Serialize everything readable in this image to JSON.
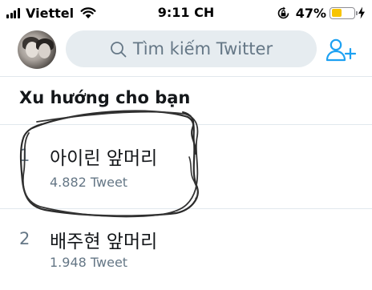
{
  "status_bar": {
    "carrier": "Viettel",
    "time": "9:11 CH",
    "battery_percent": "47%",
    "battery_level": 0.47,
    "icons": [
      "signal-icon",
      "wifi-icon",
      "rotation-lock-icon",
      "battery-icon",
      "charging-icon"
    ]
  },
  "header": {
    "avatar": "profile-avatar",
    "search": {
      "placeholder": "Tìm kiếm Twitter"
    },
    "add_user_icon": "add-user-icon"
  },
  "section": {
    "title": "Xu hướng cho bạn"
  },
  "trends": [
    {
      "rank": "1",
      "name": "아이린 앞머리",
      "count": "4.882 Tweet"
    },
    {
      "rank": "2",
      "name": "배주현 앞머리",
      "count": "1.948 Tweet"
    }
  ],
  "colors": {
    "accent": "#1da1f2",
    "search_bg": "#e6ecf0",
    "secondary_text": "#657786",
    "primary_text": "#14171a",
    "battery_fill": "#f7c400",
    "divider": "#e1e8ed"
  }
}
